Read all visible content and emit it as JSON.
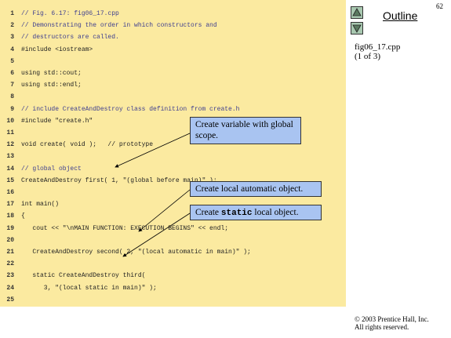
{
  "slide": {
    "page_number": "62",
    "outline_title": "Outline",
    "file_name": "fig06_17.cpp",
    "page_of": "(1 of 3)",
    "copyright_line1": "© 2003 Prentice Hall, Inc.",
    "copyright_line2": "All rights reserved."
  },
  "code_lines": [
    {
      "num": "1",
      "text": "// Fig. 6.17: fig06_17.cpp",
      "cls": "cm"
    },
    {
      "num": "2",
      "text": "// Demonstrating the order in which constructors and",
      "cls": "cm"
    },
    {
      "num": "3",
      "text": "// destructors are called.",
      "cls": "cm"
    },
    {
      "num": "4",
      "text": "#include <iostream>",
      "cls": ""
    },
    {
      "num": "5",
      "text": "",
      "cls": ""
    },
    {
      "num": "6",
      "text": "using std::cout;",
      "cls": ""
    },
    {
      "num": "7",
      "text": "using std::endl;",
      "cls": ""
    },
    {
      "num": "8",
      "text": "",
      "cls": ""
    },
    {
      "num": "9",
      "text": "// include CreateAndDestroy class definition from create.h",
      "cls": "cm"
    },
    {
      "num": "10",
      "text": "#include \"create.h\"",
      "cls": ""
    },
    {
      "num": "11",
      "text": "",
      "cls": ""
    },
    {
      "num": "12",
      "text": "void create( void );   // prototype",
      "cls": ""
    },
    {
      "num": "13",
      "text": "",
      "cls": ""
    },
    {
      "num": "14",
      "text": "// global object",
      "cls": "cm"
    },
    {
      "num": "15",
      "text": "CreateAndDestroy first( 1, \"(global before main)\" );",
      "cls": ""
    },
    {
      "num": "16",
      "text": "",
      "cls": ""
    },
    {
      "num": "17",
      "text": "int main()",
      "cls": ""
    },
    {
      "num": "18",
      "text": "{",
      "cls": ""
    },
    {
      "num": "19",
      "text": "   cout << \"\\nMAIN FUNCTION: EXECUTION BEGINS\" << endl;",
      "cls": ""
    },
    {
      "num": "20",
      "text": "",
      "cls": ""
    },
    {
      "num": "21",
      "text": "   CreateAndDestroy second( 2, \"(local automatic in main)\" );",
      "cls": ""
    },
    {
      "num": "22",
      "text": "",
      "cls": ""
    },
    {
      "num": "23",
      "text": "   static CreateAndDestroy third(",
      "cls": ""
    },
    {
      "num": "24",
      "text": "      3, \"(local static in main)\" );",
      "cls": ""
    },
    {
      "num": "25",
      "text": "",
      "cls": ""
    }
  ],
  "callouts": {
    "global": "Create variable with global scope.",
    "local_auto": "Create local automatic object.",
    "static_pre": "Create ",
    "static_kw": "static",
    "static_post": " local object."
  },
  "colors": {
    "code_background": "#fbeaa0",
    "callout_background": "#a9c4f1",
    "nav_button": "#a8c8b0"
  },
  "icons": [
    "up-arrow-icon",
    "down-arrow-icon"
  ]
}
